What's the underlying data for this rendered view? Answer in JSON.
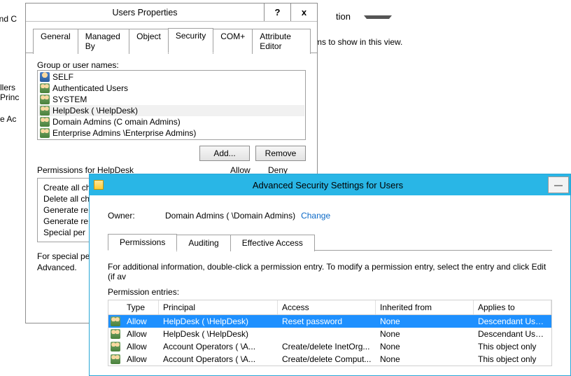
{
  "background": {
    "textTop": "and C",
    "dropdownLabel": "tion",
    "noItems": "ms to show in this view.",
    "leftCut1": "llers",
    "leftCut2": "Princ",
    "leftCut3": "e Ac"
  },
  "dialog": {
    "title": "Users Properties",
    "help": "?",
    "close": "x",
    "tabs": [
      "General",
      "Managed By",
      "Object",
      "Security",
      "COM+",
      "Attribute Editor"
    ],
    "activeTab": 3,
    "groupLabel": "Group or user names:",
    "users": [
      {
        "icon": "user",
        "name": "SELF"
      },
      {
        "icon": "group",
        "name": "Authenticated Users"
      },
      {
        "icon": "group",
        "name": "SYSTEM"
      },
      {
        "icon": "group",
        "name": "HelpDesk (            \\HelpDesk)",
        "selected": true
      },
      {
        "icon": "group",
        "name": "Domain Admins (C           omain Admins)"
      },
      {
        "icon": "group",
        "name": "Enterprise Admins              \\Enterprise Admins)"
      }
    ],
    "addBtn": "Add...",
    "removeBtn": "Remove",
    "permFor": "Permissions for HelpDesk",
    "allow": "Allow",
    "deny": "Deny",
    "permLines": [
      "Create all ch",
      "Delete all ch",
      "Generate re",
      "Generate re",
      "Special per"
    ],
    "specialLine1": "For special per",
    "specialLine2": "Advanced."
  },
  "adv": {
    "title": "Advanced Security Settings for Users",
    "minimize": "—",
    "ownerLabel": "Owner:",
    "ownerValue": "Domain Admins (          \\Domain Admins)",
    "changeLink": "Change",
    "tabs": [
      "Permissions",
      "Auditing",
      "Effective Access"
    ],
    "activeTab": 0,
    "helpText": "For additional information, double-click a permission entry. To modify a permission entry, select the entry and click Edit (if av",
    "entriesLabel": "Permission entries:",
    "columns": {
      "type": "Type",
      "principal": "Principal",
      "access": "Access",
      "inherited": "Inherited from",
      "applies": "Applies to"
    },
    "rows": [
      {
        "type": "Allow",
        "principal": "HelpDesk (         \\HelpDesk)",
        "access": "Reset password",
        "inherited": "None",
        "applies": "Descendant User objects",
        "selected": true
      },
      {
        "type": "Allow",
        "principal": "HelpDesk (         \\HelpDesk)",
        "access": "",
        "inherited": "None",
        "applies": "Descendant User objects"
      },
      {
        "type": "Allow",
        "principal": "Account Operators (       \\A...",
        "access": "Create/delete InetOrg...",
        "inherited": "None",
        "applies": "This object only"
      },
      {
        "type": "Allow",
        "principal": "Account Operators (       \\A...",
        "access": "Create/delete Comput...",
        "inherited": "None",
        "applies": "This object only"
      }
    ]
  }
}
